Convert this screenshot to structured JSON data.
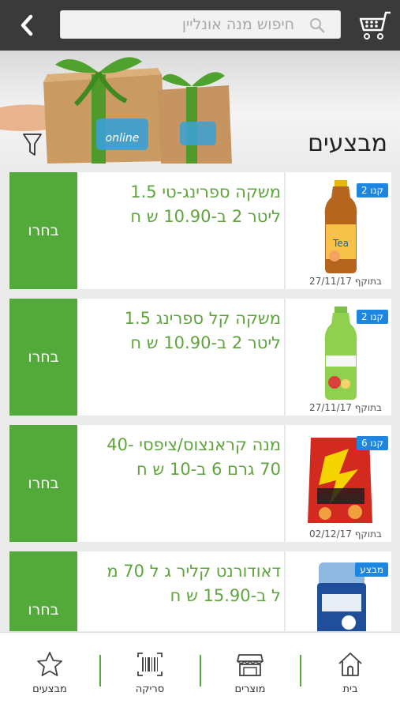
{
  "header": {
    "search_placeholder": "חיפוש מנה אונליין"
  },
  "banner": {
    "brand_logo_text": "online"
  },
  "page": {
    "title": "מבצעים"
  },
  "deals": [
    {
      "badge": "קנו 2",
      "description": "משקה ספרינג-טי 1.5 ליטר 2 ב-10.90 ש ח",
      "validity": "בתוקף 27/11/17",
      "button": "בחרו",
      "product_icon": "iced-tea-bottle"
    },
    {
      "badge": "קנו 2",
      "description": "משקה קל ספרינג 1.5 ליטר 2 ב-10.90 ש ח",
      "validity": "בתוקף 27/11/17",
      "button": "בחרו",
      "product_icon": "green-drink-bottle"
    },
    {
      "badge": "קנו 6",
      "description": "מנה קראנצוס/ציפסי -40 70 גרם 6 ב-10 ש ח",
      "validity": "בתוקף 02/12/17",
      "button": "בחרו",
      "product_icon": "chips-bag"
    },
    {
      "badge": "מבצע",
      "description": "דאודורנט קליר ג ל 70 מ ל ב-15.90 ש ח",
      "validity": "",
      "button": "בחרו",
      "product_icon": "deodorant-stick"
    }
  ],
  "nav": {
    "home": "בית",
    "products": "מוצרים",
    "scan": "סריקה",
    "deals": "מבצעים"
  },
  "colors": {
    "accent_green": "#53a939",
    "badge_blue": "#1f86e0",
    "topbar": "#3a3a3a"
  }
}
